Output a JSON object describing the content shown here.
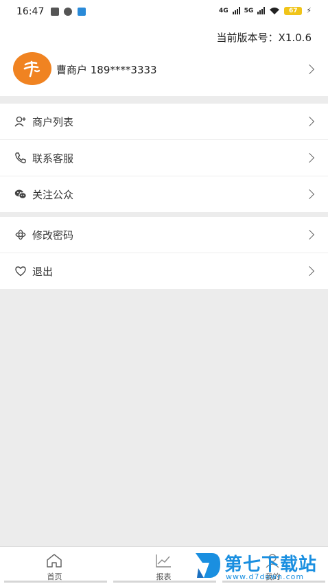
{
  "status_bar": {
    "time": "16:47",
    "network_1": "4G",
    "network_2": "5G",
    "battery": "67"
  },
  "header": {
    "version_label": "当前版本号：X1.0.6"
  },
  "profile": {
    "name": "曹商户 189****3333",
    "avatar_color": "#f08321"
  },
  "menu_group_1": [
    {
      "label": "商户列表",
      "icon": "person-add-icon"
    },
    {
      "label": "联系客服",
      "icon": "phone-icon"
    },
    {
      "label": "关注公众",
      "icon": "wechat-icon"
    }
  ],
  "menu_group_2": [
    {
      "label": "修改密码",
      "icon": "flower-icon"
    },
    {
      "label": "退出",
      "icon": "heart-icon"
    }
  ],
  "tabbar": {
    "tabs": [
      {
        "label": "首页",
        "icon": "home-icon"
      },
      {
        "label": "报表",
        "icon": "chart-icon"
      },
      {
        "label": "我的",
        "icon": "user-icon"
      }
    ]
  },
  "watermark": {
    "title": "第七下载站",
    "subtitle": "www.d7down.com"
  }
}
